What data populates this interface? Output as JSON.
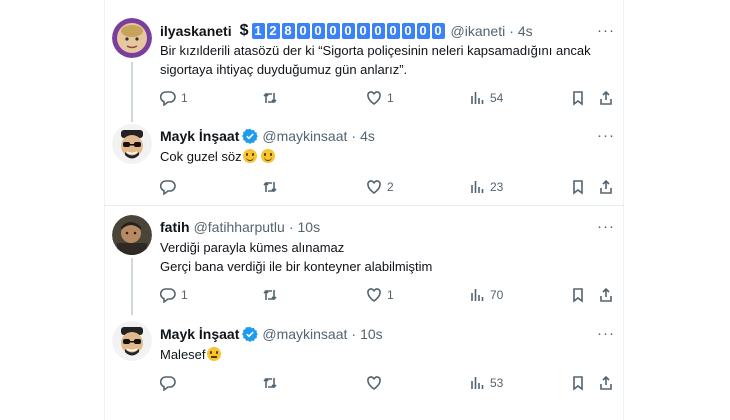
{
  "tweets": [
    {
      "name": "ilyaskaneti",
      "dollar": "$",
      "digits": [
        "1",
        "2",
        "8",
        "0",
        "0",
        "0",
        "0",
        "0",
        "0",
        "0",
        "0",
        "0",
        "0"
      ],
      "handle": "@ikaneti",
      "time": "4s",
      "text_lines": [
        "Bir kızılderili atasözü der ki “Sigorta poliçesinin neleri kapsamadığını ancak",
        "sigortaya ihtiyaç duyduğumuz gün anlarız”."
      ],
      "replies": "1",
      "retweets": "",
      "likes": "1",
      "views": "54"
    },
    {
      "name": "Mayk İnşaat",
      "verified": true,
      "handle": "@maykinsaat",
      "time": "4s",
      "text": "Cok guzel söz",
      "emoji": [
        "grinning-face",
        "grinning-face"
      ],
      "replies": "",
      "retweets": "",
      "likes": "2",
      "views": "23"
    },
    {
      "name": "fatih",
      "handle": "@fatihharputlu",
      "time": "10s",
      "text_lines": [
        "Verdiği parayla kümes alınamaz",
        "Gerçi bana verdiği ile bir konteyner alabilmiştim"
      ],
      "replies": "1",
      "retweets": "",
      "likes": "1",
      "views": "70"
    },
    {
      "name": "Mayk İnşaat",
      "verified": true,
      "handle": "@maykinsaat",
      "time": "10s",
      "text": "Malesef",
      "emoji": [
        "pensive-face"
      ],
      "replies": "",
      "retweets": "",
      "likes": "",
      "views": "53"
    }
  ],
  "separator": "·",
  "more_glyph": "···",
  "colors": {
    "verified": "#1d9bf0",
    "thread_line": "#cfd9de",
    "muted_text": "#536471",
    "digit_box": "#3b82f6"
  }
}
